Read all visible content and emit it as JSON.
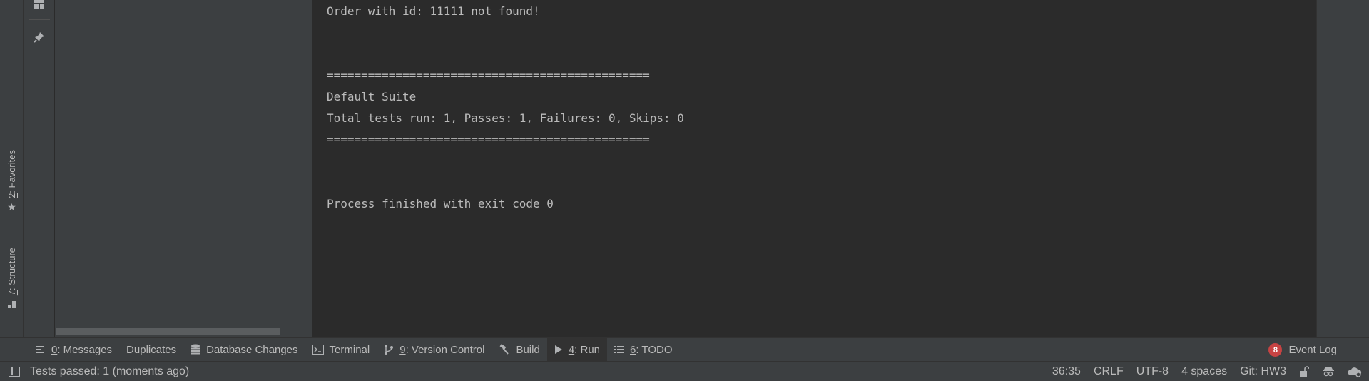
{
  "left_strip": {
    "favorites": {
      "number": "2",
      "label": ": Favorites",
      "icon": "star-icon"
    },
    "structure": {
      "number": "7",
      "label": ": Structure",
      "icon": "structure-icon"
    }
  },
  "tool_strip": {
    "icons": [
      "layout-icon",
      "pin-icon"
    ]
  },
  "console": {
    "lines": [
      "Order with id: 11111 not found!",
      "",
      "",
      "===============================================",
      "Default Suite",
      "Total tests run: 1, Passes: 1, Failures: 0, Skips: 0",
      "===============================================",
      "",
      "",
      "Process finished with exit code 0"
    ]
  },
  "tabs": [
    {
      "num": "0",
      "label": ": Messages",
      "icon": "messages-icon"
    },
    {
      "num": "",
      "label": "Duplicates",
      "icon": ""
    },
    {
      "num": "",
      "label": "Database Changes",
      "icon": "database-icon"
    },
    {
      "num": "",
      "label": "Terminal",
      "icon": "terminal-icon"
    },
    {
      "num": "9",
      "label": ": Version Control",
      "icon": "version-control-icon"
    },
    {
      "num": "",
      "label": "Build",
      "icon": "hammer-icon"
    },
    {
      "num": "4",
      "label": ": Run",
      "icon": "run-icon"
    },
    {
      "num": "6",
      "label": ": TODO",
      "icon": "todo-icon"
    }
  ],
  "event_log": {
    "badge": "8",
    "label": "Event Log"
  },
  "status": {
    "message": "Tests passed: 1 (moments ago)",
    "position": "36:35",
    "line_separator": "CRLF",
    "encoding": "UTF-8",
    "indent": "4 spaces",
    "vcs": "Git: HW3"
  },
  "colors": {
    "background": "#2b2b2b",
    "panel": "#3c3f41",
    "text": "#bbbbbb",
    "badge": "#c74343"
  }
}
